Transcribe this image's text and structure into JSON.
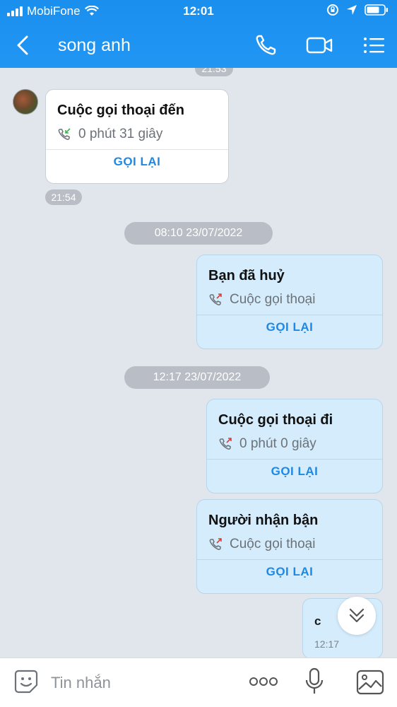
{
  "status_bar": {
    "carrier": "MobiFone",
    "time": "12:01"
  },
  "header": {
    "title": "song anh",
    "icons": [
      "back-icon",
      "phone-icon",
      "video-call-icon",
      "menu-list-icon"
    ]
  },
  "chat": {
    "top_time_chip": "21:53",
    "messages": [
      {
        "direction": "in",
        "title": "Cuộc gọi thoại đến",
        "detail": "0 phút 31 giây",
        "action": "GỌI LẠI",
        "time": "21:54"
      },
      {
        "direction": "out",
        "title": "Bạn đã huỷ",
        "detail": "Cuộc gọi thoại",
        "action": "GỌI LẠI"
      },
      {
        "direction": "out",
        "title": "Cuộc gọi thoại đi",
        "detail": "0 phút 0 giây",
        "action": "GỌI LẠI"
      },
      {
        "direction": "out",
        "title": "Người nhận bận",
        "detail": "Cuộc gọi thoại",
        "action": "GỌI LẠI"
      },
      {
        "direction": "out",
        "text": "c",
        "time": "12:17"
      }
    ],
    "date_chips": [
      "08:10 23/07/2022",
      "12:17 23/07/2022"
    ]
  },
  "composer": {
    "placeholder": "Tin nhắn"
  },
  "colors": {
    "header_blue": "#2196f3",
    "outgoing_bubble": "#d4ecfb",
    "action_blue": "#1e88e5"
  }
}
